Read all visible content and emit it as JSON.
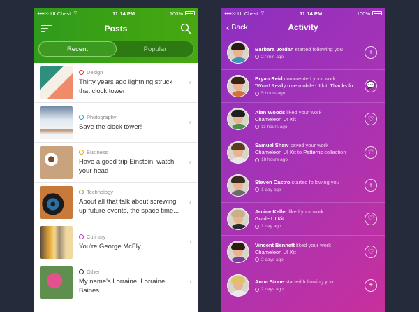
{
  "status": {
    "carrier": "UI Chest",
    "time": "11:14 PM",
    "battery": "100%"
  },
  "posts_screen": {
    "title": "Posts",
    "tabs": [
      "Recent",
      "Popular"
    ],
    "items": [
      {
        "category": "Design",
        "title": "Thirty years ago lightning struck that clock tower",
        "color": "#d9372b",
        "icon": "paper-art-thumbnail"
      },
      {
        "category": "Photography",
        "title": "Save the clock tower!",
        "color": "#1fa3c8",
        "icon": "deer-snow-thumbnail"
      },
      {
        "category": "Business",
        "title": "Have a good trip Einstein, watch your head",
        "color": "#f0a500",
        "icon": "coffee-desk-thumbnail"
      },
      {
        "category": "Technology",
        "title": "About all that talk about screwing up future events, the space time...",
        "color": "#77b82a",
        "icon": "vinyl-records-thumbnail"
      },
      {
        "category": "Culinary",
        "title": "You're George McFly",
        "color": "#c62fb8",
        "icon": "beer-glass-thumbnail"
      },
      {
        "category": "Other",
        "title": "My name's Lorraine, Lorraine Baines",
        "color": "#333333",
        "icon": "pink-flower-thumbnail"
      }
    ]
  },
  "activity_screen": {
    "back": "Back",
    "title": "Activity",
    "items": [
      {
        "name": "Barbara Jordan",
        "verb": " started following you",
        "detail": "",
        "time": "27 min ago",
        "action": "follow-plus-icon",
        "glyph": "+"
      },
      {
        "name": "Bryan Reid",
        "verb": " commented your work:",
        "detail": "\"Wow! Really nice mobile UI kit! Thanks fo...",
        "time": "5 hours ago",
        "action": "comment-icon",
        "glyph": "💬"
      },
      {
        "name": "Alan Woods",
        "verb": " liked your work",
        "detail": "Chameleon UI Kit",
        "time": "11 hours ago",
        "action": "heart-icon",
        "glyph": "♡"
      },
      {
        "name": "Samuel Shaw",
        "verb": " saved your work",
        "detail": "Chameleon UI Kit",
        "detail2": " to ",
        "detail3": "Patterns",
        "detail4": " collection",
        "time": "18 hours ago",
        "action": "star-icon",
        "glyph": "☆"
      },
      {
        "name": "Steven Castro",
        "verb": " started following you",
        "detail": "",
        "time": "1 day ago",
        "action": "follow-plus-icon",
        "glyph": "+"
      },
      {
        "name": "Janice Keller",
        "verb": " liked your work",
        "detail": "Grade UI Kit",
        "time": "1 day ago",
        "action": "heart-icon",
        "glyph": "♡"
      },
      {
        "name": "Vincent Bennett",
        "verb": " liked your work",
        "detail": "Chameleon UI Kit",
        "time": "2 days ago",
        "action": "heart-icon",
        "glyph": "♡"
      },
      {
        "name": "Anna Stone",
        "verb": " started following you",
        "detail": "",
        "time": "2 days ago",
        "action": "follow-plus-icon",
        "glyph": "+"
      }
    ]
  },
  "colors": {
    "green": "#3ea313",
    "purple": "#a533b6",
    "magenta": "#c8309c",
    "background": "#262b3b"
  }
}
